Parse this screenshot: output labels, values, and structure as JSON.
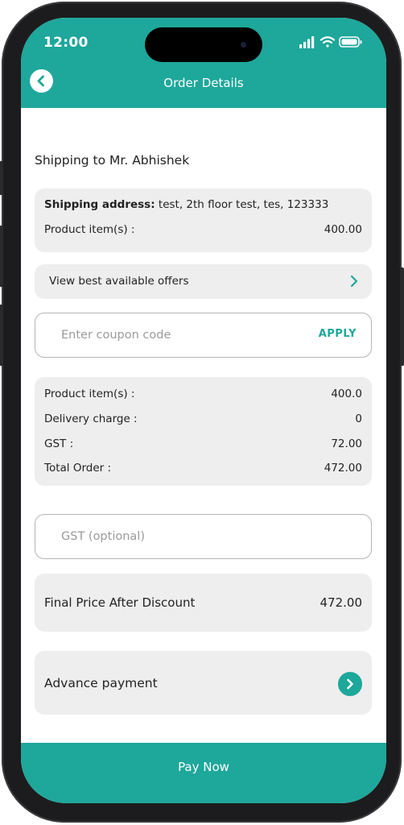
{
  "status_bar": {
    "time": "12:00"
  },
  "header": {
    "title": "Order Details"
  },
  "shipping": {
    "title": "Shipping to Mr. Abhishek",
    "address_label": "Shipping address:",
    "address_value": "test, 2th floor test, tes, 123333",
    "product_label": "Product item(s) :",
    "product_value": "400.00"
  },
  "offers": {
    "label": "View best available offers"
  },
  "coupon": {
    "placeholder": "Enter coupon code",
    "apply_label": "APPLY"
  },
  "summary": {
    "rows": [
      {
        "label": "Product item(s) :",
        "value": "400.0"
      },
      {
        "label": "Delivery charge :",
        "value": "0"
      },
      {
        "label": "GST :",
        "value": "72.00"
      },
      {
        "label": "Total Order :",
        "value": "472.00"
      }
    ]
  },
  "gst": {
    "placeholder": "GST (optional)"
  },
  "final_price": {
    "label": "Final Price After Discount",
    "value": "472.00"
  },
  "advance": {
    "label": "Advance payment"
  },
  "footer": {
    "pay_label": "Pay Now"
  },
  "colors": {
    "accent": "#1ea79b",
    "card": "#eeeeee"
  },
  "icons": [
    "back-arrow-icon",
    "signal-icon",
    "wifi-icon",
    "battery-icon",
    "chevron-right-icon",
    "arrow-circle-right-icon"
  ]
}
